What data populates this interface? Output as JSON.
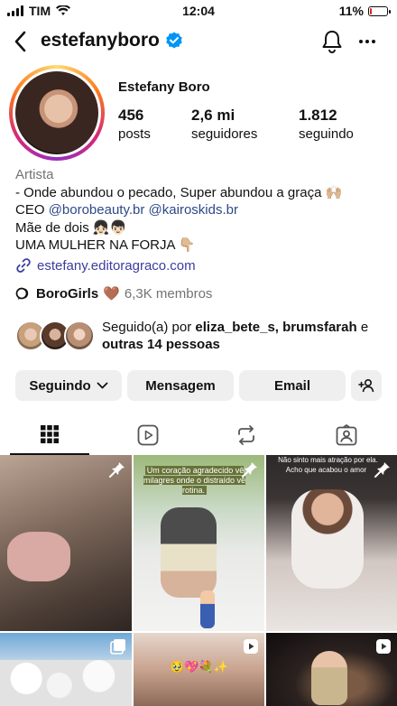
{
  "status": {
    "carrier": "TIM",
    "time": "12:04",
    "battery": "11%",
    "battery_level": 0.11
  },
  "header": {
    "username": "estefanyboro"
  },
  "profile": {
    "full_name": "Estefany Boro",
    "stats": [
      {
        "value": "456",
        "label": "posts"
      },
      {
        "value": "2,6 mi",
        "label": "seguidores"
      },
      {
        "value": "1.812",
        "label": "seguindo"
      }
    ],
    "category": "Artista",
    "bio": {
      "line1": "- Onde abundou o pecado, Super abundou a graça 🙌🏼",
      "line2_prefix": "CEO ",
      "mention1": "@borobeauty.br",
      "mention2": "@kairoskids.br",
      "line3": "Mãe de dois 👧🏻👦🏻",
      "line4": "UMA MULHER NA FORJA 👇🏼"
    },
    "link": "estefany.editoragraco.com",
    "channel": {
      "name": "BoroGirls",
      "emoji": "🤎",
      "members": "6,3K membros"
    },
    "followed_by": {
      "prefix": "Seguido(a) por ",
      "names": "eliza_bete_s, brumsfarah",
      "joiner": " e ",
      "others": "outras 14 pessoas"
    }
  },
  "actions": {
    "following": "Seguindo",
    "message": "Mensagem",
    "email": "Email"
  },
  "grid": {
    "captions": {
      "post2": "Um coração agradecido vê milagres onde o distraído vê rotina.",
      "post3": "Não sinto mais atração por ela. Acho que acabou o amor"
    },
    "post5_emoji": "🥹💖💐✨"
  },
  "icons": [
    "back-icon",
    "verified-icon",
    "bell-icon",
    "more-icon",
    "link-icon",
    "channel-icon",
    "add-person-icon",
    "grid-icon",
    "reels-icon",
    "repost-icon",
    "tagged-icon",
    "pin-icon",
    "reel-icon"
  ],
  "colors": {
    "verified": "#0095f6",
    "link": "#3b3d9e",
    "mention": "#2c4a87",
    "button_bg": "#efefef",
    "muted": "#737373"
  }
}
